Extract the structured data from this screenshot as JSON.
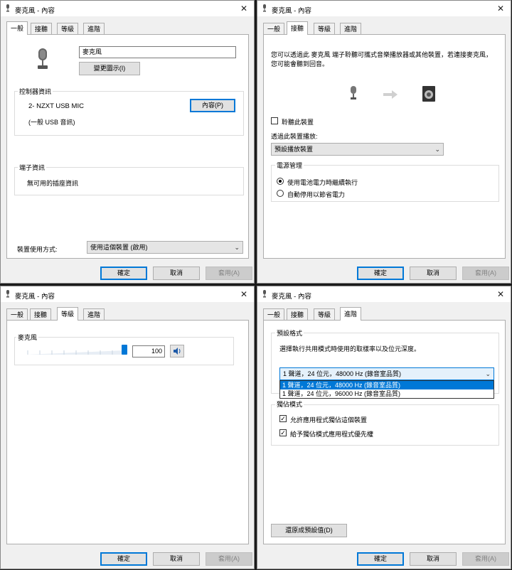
{
  "window_title": "麥克風 - 內容",
  "tabs": [
    "一般",
    "接聽",
    "等級",
    "進階"
  ],
  "buttons": {
    "ok": "確定",
    "cancel": "取消",
    "apply": "套用(A)"
  },
  "general": {
    "device_name": "麥克風",
    "change_icon": "變更圖示(I)",
    "controller_group": "控制器資訊",
    "controller_name": "2- NZXT USB MIC",
    "controller_type": "(一般 USB 音訊)",
    "properties_button": "內容(P)",
    "jack_group": "端子資訊",
    "jack_info": "無可用的插座資訊",
    "usage_label": "裝置使用方式:",
    "usage_value": "使用這個裝置 (啟用)"
  },
  "listen": {
    "description": "您可以透過此 麥克風 端子聆聽可攜式音樂播放器或其他裝置，若連接麥克風，您可能會聽到回音。",
    "listen_checkbox": "聆聽此裝置",
    "playback_label": "透過此裝置播放:",
    "playback_value": "預設播放裝置",
    "power_group": "電源管理",
    "power_option_1": "使用電池電力時繼續執行",
    "power_option_2": "自動停用以節省電力",
    "power_selected": 0
  },
  "levels": {
    "mic_label": "麥克風",
    "level_value": "100",
    "level_fraction": 1.0
  },
  "advanced": {
    "default_format_group": "預設格式",
    "default_format_desc": "選擇執行共用模式時使用的取樣率以及位元深度。",
    "format_selected": "1 聲道，24 位元，48000 Hz (錄音室品質)",
    "format_options": [
      "1 聲道，24 位元，48000 Hz (錄音室品質)",
      "1 聲道，24 位元，96000 Hz (錄音室品質)"
    ],
    "exclusive_group": "獨佔模式",
    "exclusive_1": "允許應用程式獨佔這個裝置",
    "exclusive_2": "給予獨佔模式應用程式優先權",
    "restore_defaults": "還原成預設值(D)"
  },
  "icons": [
    "microphone-icon",
    "arrow-right-icon",
    "speaker-icon",
    "speaker-volume-icon",
    "chevron-down-icon",
    "close-icon"
  ]
}
